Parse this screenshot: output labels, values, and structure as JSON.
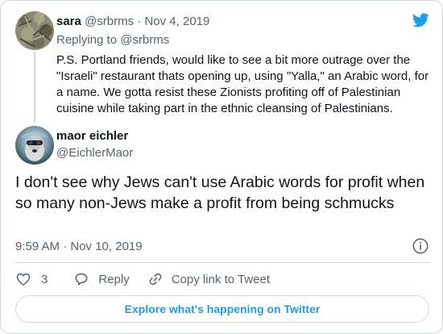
{
  "colors": {
    "brand": "#1d9bf0",
    "text": "#0f1419",
    "muted": "#536471",
    "border": "#cfd9de"
  },
  "parent_tweet": {
    "author_name": "sara",
    "author_handle": "@srbrms",
    "separator": "·",
    "date": "Nov 4, 2019",
    "replying_to": "Replying to @srbrms",
    "text": "P.S. Portland friends, would like to see a bit more outrage over the \"Israeli\" restaurant thats opening up, using \"Yalla,\" an Arabic word, for a name. We gotta resist these Zionists profiting off of Palestinian cuisine while taking part in the ethnic cleansing of Palestinians.",
    "avatar_icon": "avatar-sara"
  },
  "tweet": {
    "author_name": "maor eichler",
    "author_handle": "@EichlerMaor",
    "text": "I don't see why Jews can't use Arabic words for profit when so many non-Jews make a profit from being schmucks",
    "timestamp": "9:59 AM · Nov 10, 2019",
    "avatar_icon": "avatar-maor"
  },
  "actions": {
    "like_count": "3",
    "reply_label": "Reply",
    "copy_link_label": "Copy link to Tweet"
  },
  "explore_button": "Explore what's happening on Twitter",
  "icons": [
    "twitter-bird-icon",
    "info-icon",
    "heart-icon",
    "reply-icon",
    "link-icon"
  ]
}
